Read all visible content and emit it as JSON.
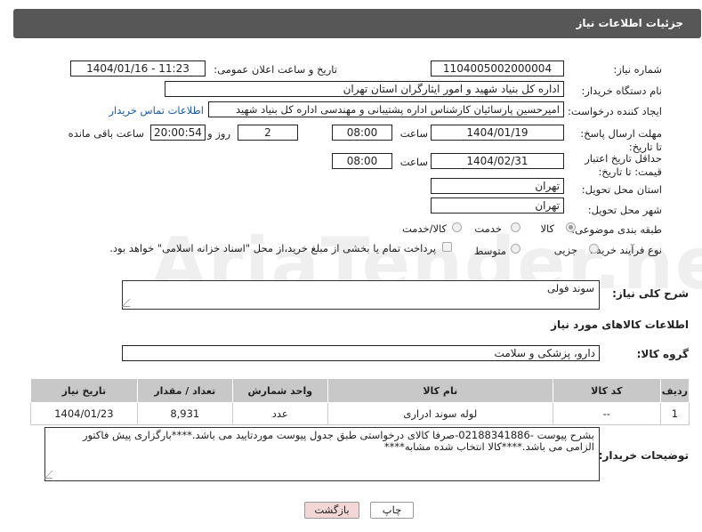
{
  "header": {
    "title": "جزئیات اطلاعات نیاز"
  },
  "fields": {
    "need_number_label": "شماره نیاز:",
    "need_number": "1104005002000004",
    "announce_label": "تاریخ و ساعت اعلان عمومی:",
    "announce_value": "1404/01/16 - 11:23",
    "buyer_label": "نام دستگاه خریدار:",
    "buyer_value": "اداره کل بنیاد شهید و امور ایثارگران استان تهران",
    "creator_label": "ایجاد کننده درخواست:",
    "creator_value": "امیرحسین پارسائیان کارشناس اداره پشتیبانی و مهندسی  اداره کل بنیاد شهید",
    "contact_link": "اطلاعات تماس خریدار",
    "deadline_label": "مهلت ارسال پاسخ: تا تاریخ:",
    "deadline_date": "1404/01/19",
    "hour_label": "ساعت",
    "deadline_time": "08:00",
    "days_value": "2",
    "days_label": "روز و",
    "remaining_time": "20:00:54",
    "remaining_label": "ساعت باقی مانده",
    "min_validity_label": "حداقل تاریخ اعتبار قیمت: تا تاریخ:",
    "validity_date": "1404/02/31",
    "validity_hour_label": "ساعت",
    "validity_time": "08:00",
    "province_label": "استان محل تحویل:",
    "province_value": "تهران",
    "city_label": "شهر محل تحویل:",
    "city_value": "تهران",
    "category_label": "طبقه بندی موضوعی:",
    "category_options": [
      "کالا",
      "خدمت",
      "کالا/خدمت"
    ],
    "purchase_label": "نوع فرآیند خرید :",
    "purchase_options": [
      "جزیی",
      "متوسط"
    ],
    "payment_text": "پرداخت تمام یا بخشی از مبلغ خرید،از محل \"اسناد خزانه اسلامی\" خواهد بود."
  },
  "general_desc": {
    "label": "شرح کلی نیاز:",
    "value": "سوند فولی"
  },
  "goods_section_title": "اطلاعات کالاهای مورد نیاز",
  "goods_group": {
    "label": "گروه کالا:",
    "value": "دارو، پزشکی و سلامت"
  },
  "table": {
    "headers": [
      "ردیف",
      "کد کالا",
      "نام کالا",
      "واحد شمارش",
      "تعداد / مقدار",
      "تاریخ نیاز"
    ],
    "rows": [
      [
        "1",
        "--",
        "لوله سوند ادراری",
        "عدد",
        "8,931",
        "1404/01/23"
      ]
    ]
  },
  "buyer_notes": {
    "label": "توضیحات خریدار:",
    "line1": "بشرح پیوست -02188341886-صرفا کالای درخواستی طبق جدول پیوست موردتایید می باشد.****بارگزاری پیش فاکتور",
    "line2": "الزامی می باشد.****کالا انتخاب شده مشابه****"
  },
  "buttons": {
    "print": "چاپ",
    "back": "بازگشت"
  },
  "watermark": "AriaTender.neT"
}
